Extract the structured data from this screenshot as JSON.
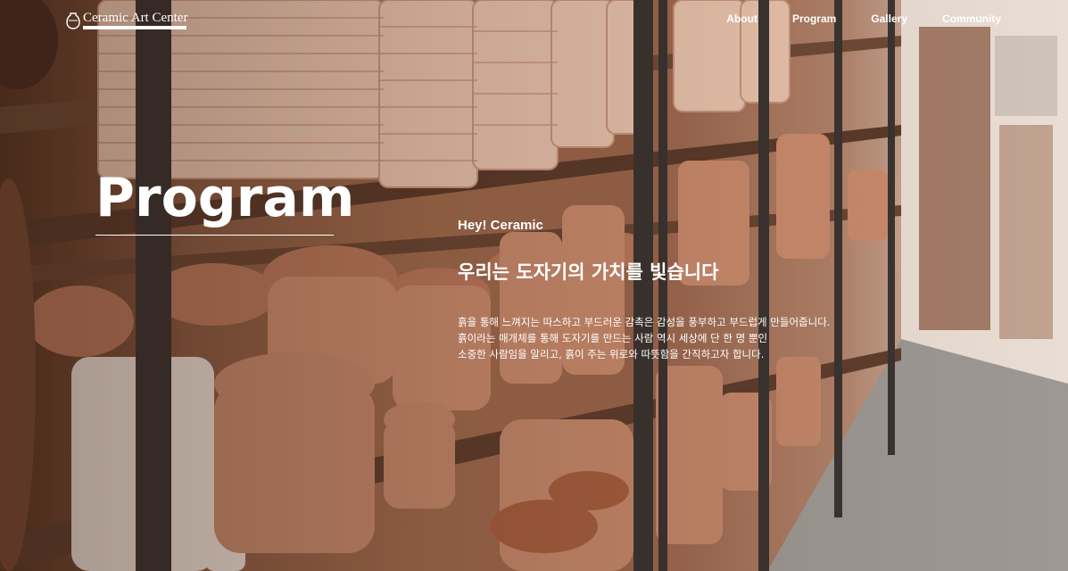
{
  "header": {
    "logo_text": "Ceramic Art Center",
    "nav": [
      "About",
      "Program",
      "Gallery",
      "Community"
    ]
  },
  "hero": {
    "title": "Program",
    "eyebrow": "Hey! Ceramic",
    "headline": "우리는 도자기의 가치를 빛습니다",
    "body_lines": [
      "흙을 통해 느껴지는 따스하고 부드러운 감촉은 감성을 풍부하고 부드럽게 만들어줍니다.",
      "흙이라는 매개체를 통해 도자기를 만드는 사람 역시 세상에 단 한 명 뿐인",
      "소중한 사람임을 알리고, 흙이 주는 위로와 따뜻함을 간직하고자 합니다."
    ]
  },
  "colors": {
    "text": "#ffffff",
    "clay": "#b8745a",
    "shelf_frame": "#3a3330"
  },
  "icons": {
    "logo": "vase-icon"
  }
}
